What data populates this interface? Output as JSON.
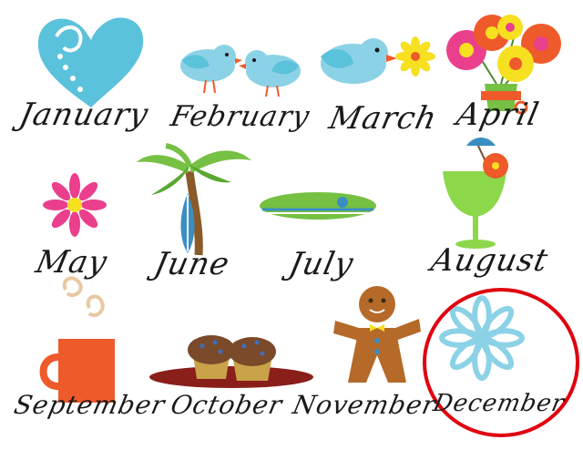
{
  "months": [
    {
      "label": "January",
      "icon": "heart-icon"
    },
    {
      "label": "February",
      "icon": "birds-icon"
    },
    {
      "label": "March",
      "icon": "bird-flower-icon"
    },
    {
      "label": "April",
      "icon": "flower-pot-icon"
    },
    {
      "label": "May",
      "icon": "daisy-icon"
    },
    {
      "label": "June",
      "icon": "palm-surfboard-icon"
    },
    {
      "label": "July",
      "icon": "surfboard-icon"
    },
    {
      "label": "August",
      "icon": "cocktail-icon"
    },
    {
      "label": "September",
      "icon": "coffee-mug-icon"
    },
    {
      "label": "October",
      "icon": "muffins-icon"
    },
    {
      "label": "November",
      "icon": "gingerbread-icon"
    },
    {
      "label": "December",
      "icon": "snowflake-icon"
    }
  ],
  "highlight": {
    "month": "December",
    "color": "#e0000f"
  },
  "colors": {
    "blue": "#5bc2dc",
    "pink": "#ea3f8c",
    "green": "#76c043",
    "orange": "#ef5a2a",
    "brown": "#b56a2a"
  }
}
